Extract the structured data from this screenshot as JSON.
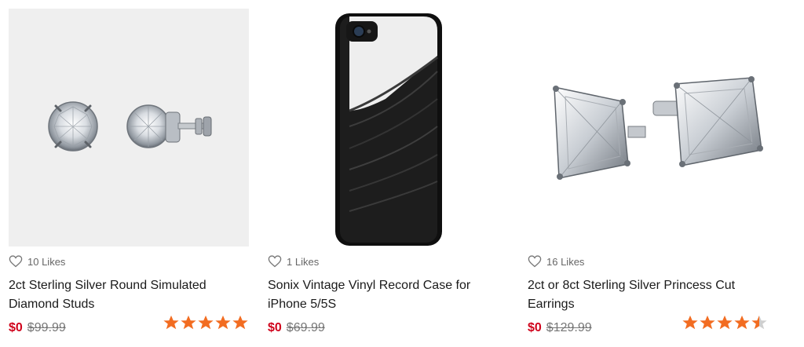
{
  "products": [
    {
      "likes": "10 Likes",
      "title": "2ct Sterling Silver Round Simulated Diamond Studs",
      "price": "$0",
      "original_price": "$99.99",
      "rating": 5,
      "image_alt": "round-stud-earrings"
    },
    {
      "likes": "1 Likes",
      "title": "Sonix Vintage Vinyl Record Case for iPhone 5/5S",
      "price": "$0",
      "original_price": "$69.99",
      "rating": null,
      "image_alt": "vinyl-phone-case"
    },
    {
      "likes": "16 Likes",
      "title": "2ct or 8ct Sterling Silver Princess Cut Earrings",
      "price": "$0",
      "original_price": "$129.99",
      "rating": 4.5,
      "image_alt": "princess-cut-earrings"
    }
  ],
  "colors": {
    "price": "#d0021b",
    "star": "#f26c21",
    "star_empty": "#cfcfcf"
  },
  "icons": {
    "like": "heart-outline-icon",
    "rating": "star-icon"
  }
}
